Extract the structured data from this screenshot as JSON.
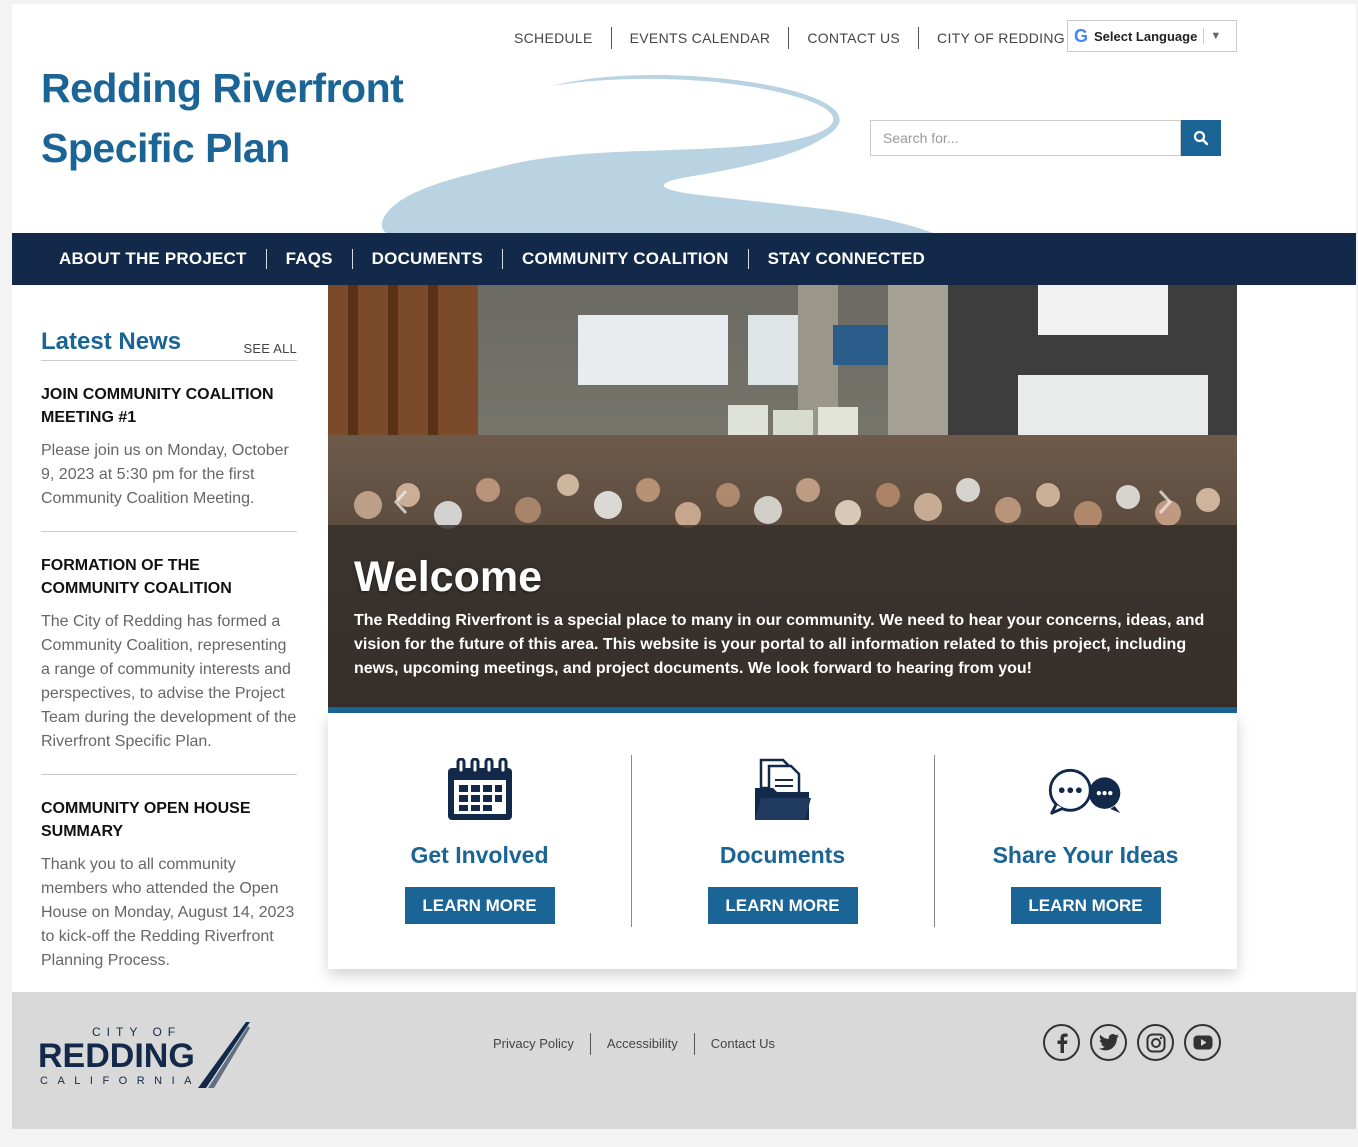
{
  "header": {
    "title_line1": "Redding Riverfront",
    "title_line2": "Specific Plan",
    "utility_links": [
      "SCHEDULE",
      "EVENTS CALENDAR",
      "CONTACT US",
      "CITY OF REDDING"
    ],
    "translate_label": "Select Language",
    "search_placeholder": "Search for..."
  },
  "nav": {
    "items": [
      "ABOUT THE PROJECT",
      "FAQS",
      "DOCUMENTS",
      "COMMUNITY COALITION",
      "STAY CONNECTED"
    ]
  },
  "sidebar": {
    "title": "Latest News",
    "see_all": "SEE ALL",
    "news": [
      {
        "title": "JOIN COMMUNITY COALITION MEETING #1",
        "body": "Please join us on Monday, October 9, 2023 at 5:30 pm for the first Community Coalition Meeting."
      },
      {
        "title": "FORMATION OF THE COMMUNITY COALITION",
        "body": "The City of Redding has formed a Community Coalition, representing a range of community interests and perspectives, to advise the Project Team during the development of the Riverfront Specific Plan."
      },
      {
        "title": "COMMUNITY OPEN HOUSE SUMMARY",
        "body": "Thank you to all community members who attended the Open House on Monday, August 14, 2023 to kick-off the Redding Riverfront Planning Process."
      }
    ]
  },
  "hero": {
    "title": "Welcome",
    "text": "The Redding Riverfront is a special place to many in our community. We need to hear your concerns, ideas, and vision for the future of this area. This website is your portal to all information related to this project, including news, upcoming meetings, and project documents. We look forward to hearing from you!"
  },
  "cards": [
    {
      "title": "Get Involved",
      "button": "LEARN MORE",
      "icon": "calendar-icon"
    },
    {
      "title": "Documents",
      "button": "LEARN MORE",
      "icon": "documents-folder-icon"
    },
    {
      "title": "Share Your Ideas",
      "button": "LEARN MORE",
      "icon": "chat-bubbles-icon"
    }
  ],
  "footer": {
    "logo_city_of": "CITY OF",
    "logo_redding": "REDDING",
    "logo_state": "CALIFORNIA",
    "links": [
      "Privacy Policy",
      "Accessibility",
      "Contact Us"
    ],
    "social": [
      "facebook-icon",
      "twitter-icon",
      "instagram-icon",
      "youtube-icon"
    ]
  },
  "colors": {
    "brand_blue": "#1a6496",
    "nav_navy": "#12294a",
    "footer_gray": "#d9d9d9",
    "river_light_blue": "#b9d3e3"
  }
}
